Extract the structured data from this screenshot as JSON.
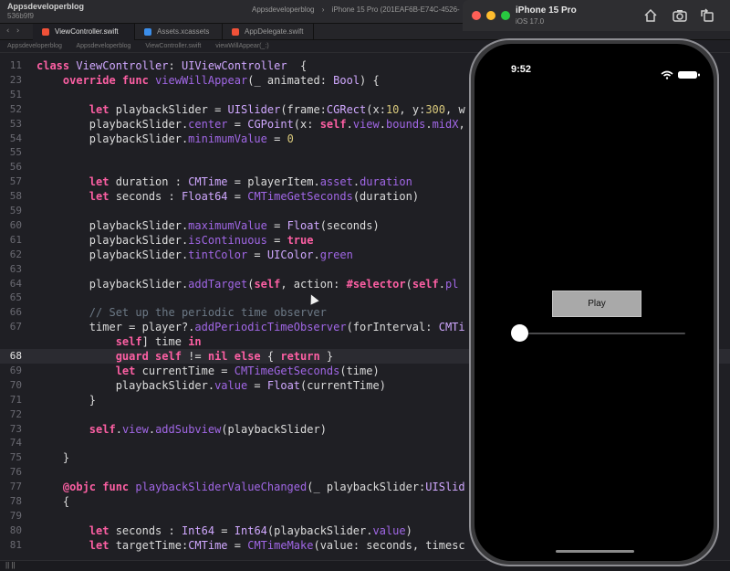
{
  "xcode": {
    "project_name": "Appsdeveloperblog",
    "project_sub": "536b9f9",
    "scheme": [
      "Appsdeveloperblog",
      "iPhone 15 Pro (201EAF6B-E74C-4526-"
    ],
    "tabs": [
      {
        "label": "ViewController.swift",
        "active": true,
        "icon_color": "#f05138"
      },
      {
        "label": "Assets.xcassets",
        "active": false,
        "icon_color": "#3b8eea"
      },
      {
        "label": "AppDelegate.swift",
        "active": false,
        "icon_color": "#f05138"
      }
    ],
    "jumpbar": [
      "Appsdeveloperblog",
      "Appsdeveloperblog",
      "ViewController.swift",
      "viewWillAppear(_:)"
    ],
    "status": "|| ||"
  },
  "code_lines": [
    {
      "n": "11",
      "tokens": [
        [
          "kw",
          "class "
        ],
        [
          "ty",
          "ViewController"
        ],
        [
          "plain",
          ": "
        ],
        [
          "ty",
          "UIViewController"
        ],
        [
          "plain",
          "  {"
        ]
      ]
    },
    {
      "n": "23",
      "tokens": [
        [
          "plain",
          "    "
        ],
        [
          "kw",
          "override func "
        ],
        [
          "fn",
          "viewWillAppear"
        ],
        [
          "plain",
          "(_ animated: "
        ],
        [
          "ty",
          "Bool"
        ],
        [
          "plain",
          ") {"
        ]
      ]
    },
    {
      "n": "51",
      "tokens": []
    },
    {
      "n": "52",
      "tokens": [
        [
          "plain",
          "        "
        ],
        [
          "kw",
          "let "
        ],
        [
          "plain",
          "playbackSlider = "
        ],
        [
          "ty",
          "UISlider"
        ],
        [
          "plain",
          "(frame:"
        ],
        [
          "ty",
          "CGRect"
        ],
        [
          "plain",
          "(x:"
        ],
        [
          "num",
          "10"
        ],
        [
          "plain",
          ", y:"
        ],
        [
          "num",
          "300"
        ],
        [
          "plain",
          ", w"
        ]
      ]
    },
    {
      "n": "53",
      "tokens": [
        [
          "plain",
          "        playbackSlider."
        ],
        [
          "fn",
          "center"
        ],
        [
          "plain",
          " = "
        ],
        [
          "ty",
          "CGPoint"
        ],
        [
          "plain",
          "(x: "
        ],
        [
          "kw",
          "self"
        ],
        [
          "plain",
          "."
        ],
        [
          "fn",
          "view"
        ],
        [
          "plain",
          "."
        ],
        [
          "fn",
          "bounds"
        ],
        [
          "plain",
          "."
        ],
        [
          "fn",
          "midX"
        ],
        [
          "plain",
          ","
        ]
      ]
    },
    {
      "n": "54",
      "tokens": [
        [
          "plain",
          "        playbackSlider."
        ],
        [
          "fn",
          "minimumValue"
        ],
        [
          "plain",
          " = "
        ],
        [
          "num",
          "0"
        ]
      ]
    },
    {
      "n": "55",
      "tokens": []
    },
    {
      "n": "56",
      "tokens": []
    },
    {
      "n": "57",
      "tokens": [
        [
          "plain",
          "        "
        ],
        [
          "kw",
          "let "
        ],
        [
          "plain",
          "duration : "
        ],
        [
          "ty",
          "CMTime"
        ],
        [
          "plain",
          " = playerItem."
        ],
        [
          "fn",
          "asset"
        ],
        [
          "plain",
          "."
        ],
        [
          "fn",
          "duration"
        ]
      ]
    },
    {
      "n": "58",
      "tokens": [
        [
          "plain",
          "        "
        ],
        [
          "kw",
          "let "
        ],
        [
          "plain",
          "seconds : "
        ],
        [
          "ty",
          "Float64"
        ],
        [
          "plain",
          " = "
        ],
        [
          "fn",
          "CMTimeGetSeconds"
        ],
        [
          "plain",
          "(duration)"
        ]
      ]
    },
    {
      "n": "59",
      "tokens": []
    },
    {
      "n": "60",
      "tokens": [
        [
          "plain",
          "        playbackSlider."
        ],
        [
          "fn",
          "maximumValue"
        ],
        [
          "plain",
          " = "
        ],
        [
          "ty",
          "Float"
        ],
        [
          "plain",
          "(seconds)"
        ]
      ]
    },
    {
      "n": "61",
      "tokens": [
        [
          "plain",
          "        playbackSlider."
        ],
        [
          "fn",
          "isContinuous"
        ],
        [
          "plain",
          " = "
        ],
        [
          "kw",
          "true"
        ]
      ]
    },
    {
      "n": "62",
      "tokens": [
        [
          "plain",
          "        playbackSlider."
        ],
        [
          "fn",
          "tintColor"
        ],
        [
          "plain",
          " = "
        ],
        [
          "ty",
          "UIColor"
        ],
        [
          "plain",
          "."
        ],
        [
          "fn",
          "green"
        ]
      ]
    },
    {
      "n": "63",
      "tokens": []
    },
    {
      "n": "64",
      "tokens": [
        [
          "plain",
          "        playbackSlider."
        ],
        [
          "fn",
          "addTarget"
        ],
        [
          "plain",
          "("
        ],
        [
          "kw",
          "self"
        ],
        [
          "plain",
          ", action: "
        ],
        [
          "kw",
          "#selector"
        ],
        [
          "plain",
          "("
        ],
        [
          "kw",
          "self"
        ],
        [
          "plain",
          "."
        ],
        [
          "fn",
          "pl"
        ]
      ]
    },
    {
      "n": "65",
      "tokens": []
    },
    {
      "n": "66",
      "tokens": [
        [
          "plain",
          "        "
        ],
        [
          "cm",
          "// Set up the periodic time observer"
        ]
      ]
    },
    {
      "n": "67",
      "tokens": [
        [
          "plain",
          "        timer = player?."
        ],
        [
          "fn",
          "addPeriodicTimeObserver"
        ],
        [
          "plain",
          "(forInterval: "
        ],
        [
          "ty",
          "CMTi"
        ]
      ]
    },
    {
      "n": "",
      "tokens": [
        [
          "plain",
          "            "
        ],
        [
          "kw",
          "self"
        ],
        [
          "plain",
          "] time "
        ],
        [
          "kw",
          "in"
        ]
      ]
    },
    {
      "n": "68",
      "tokens": [
        [
          "plain",
          "            "
        ],
        [
          "kw",
          "guard self"
        ],
        [
          "plain",
          " != "
        ],
        [
          "kw",
          "nil else"
        ],
        [
          "plain",
          " { "
        ],
        [
          "kw",
          "return"
        ],
        [
          "plain",
          " }"
        ]
      ],
      "current": true
    },
    {
      "n": "69",
      "tokens": [
        [
          "plain",
          "            "
        ],
        [
          "kw",
          "let "
        ],
        [
          "plain",
          "currentTime = "
        ],
        [
          "fn",
          "CMTimeGetSeconds"
        ],
        [
          "plain",
          "(time)"
        ]
      ]
    },
    {
      "n": "70",
      "tokens": [
        [
          "plain",
          "            playbackSlider."
        ],
        [
          "fn",
          "value"
        ],
        [
          "plain",
          " = "
        ],
        [
          "ty",
          "Float"
        ],
        [
          "plain",
          "(currentTime)"
        ]
      ]
    },
    {
      "n": "71",
      "tokens": [
        [
          "plain",
          "        }"
        ]
      ]
    },
    {
      "n": "72",
      "tokens": []
    },
    {
      "n": "73",
      "tokens": [
        [
          "plain",
          "        "
        ],
        [
          "kw",
          "self"
        ],
        [
          "plain",
          "."
        ],
        [
          "fn",
          "view"
        ],
        [
          "plain",
          "."
        ],
        [
          "fn",
          "addSubview"
        ],
        [
          "plain",
          "(playbackSlider)"
        ]
      ]
    },
    {
      "n": "74",
      "tokens": []
    },
    {
      "n": "75",
      "tokens": [
        [
          "plain",
          "    }"
        ]
      ]
    },
    {
      "n": "76",
      "tokens": []
    },
    {
      "n": "77",
      "tokens": [
        [
          "plain",
          "    "
        ],
        [
          "kw",
          "@objc func "
        ],
        [
          "fn",
          "playbackSliderValueChanged"
        ],
        [
          "plain",
          "(_ playbackSlider:"
        ],
        [
          "ty",
          "UISlid"
        ]
      ]
    },
    {
      "n": "78",
      "tokens": [
        [
          "plain",
          "    {"
        ]
      ]
    },
    {
      "n": "79",
      "tokens": []
    },
    {
      "n": "80",
      "tokens": [
        [
          "plain",
          "        "
        ],
        [
          "kw",
          "let "
        ],
        [
          "plain",
          "seconds : "
        ],
        [
          "ty",
          "Int64"
        ],
        [
          "plain",
          " = "
        ],
        [
          "ty",
          "Int64"
        ],
        [
          "plain",
          "(playbackSlider."
        ],
        [
          "fn",
          "value"
        ],
        [
          "plain",
          ")"
        ]
      ]
    },
    {
      "n": "81",
      "tokens": [
        [
          "plain",
          "        "
        ],
        [
          "kw",
          "let "
        ],
        [
          "plain",
          "targetTime:"
        ],
        [
          "ty",
          "CMTime"
        ],
        [
          "plain",
          " = "
        ],
        [
          "fn",
          "CMTimeMake"
        ],
        [
          "plain",
          "(value: seconds, timesc"
        ]
      ]
    }
  ],
  "simulator": {
    "title": "iPhone 15 Pro",
    "os": "iOS 17.0",
    "traffic_lights": [
      "#ff5f57",
      "#febc2e",
      "#28c840"
    ],
    "tools": [
      "home-icon",
      "screenshot-icon",
      "rotate-icon"
    ],
    "phone": {
      "time": "9:52",
      "play_button": "Play",
      "slider_value_fraction": 0.0,
      "slider_tint": "#34c759"
    }
  }
}
